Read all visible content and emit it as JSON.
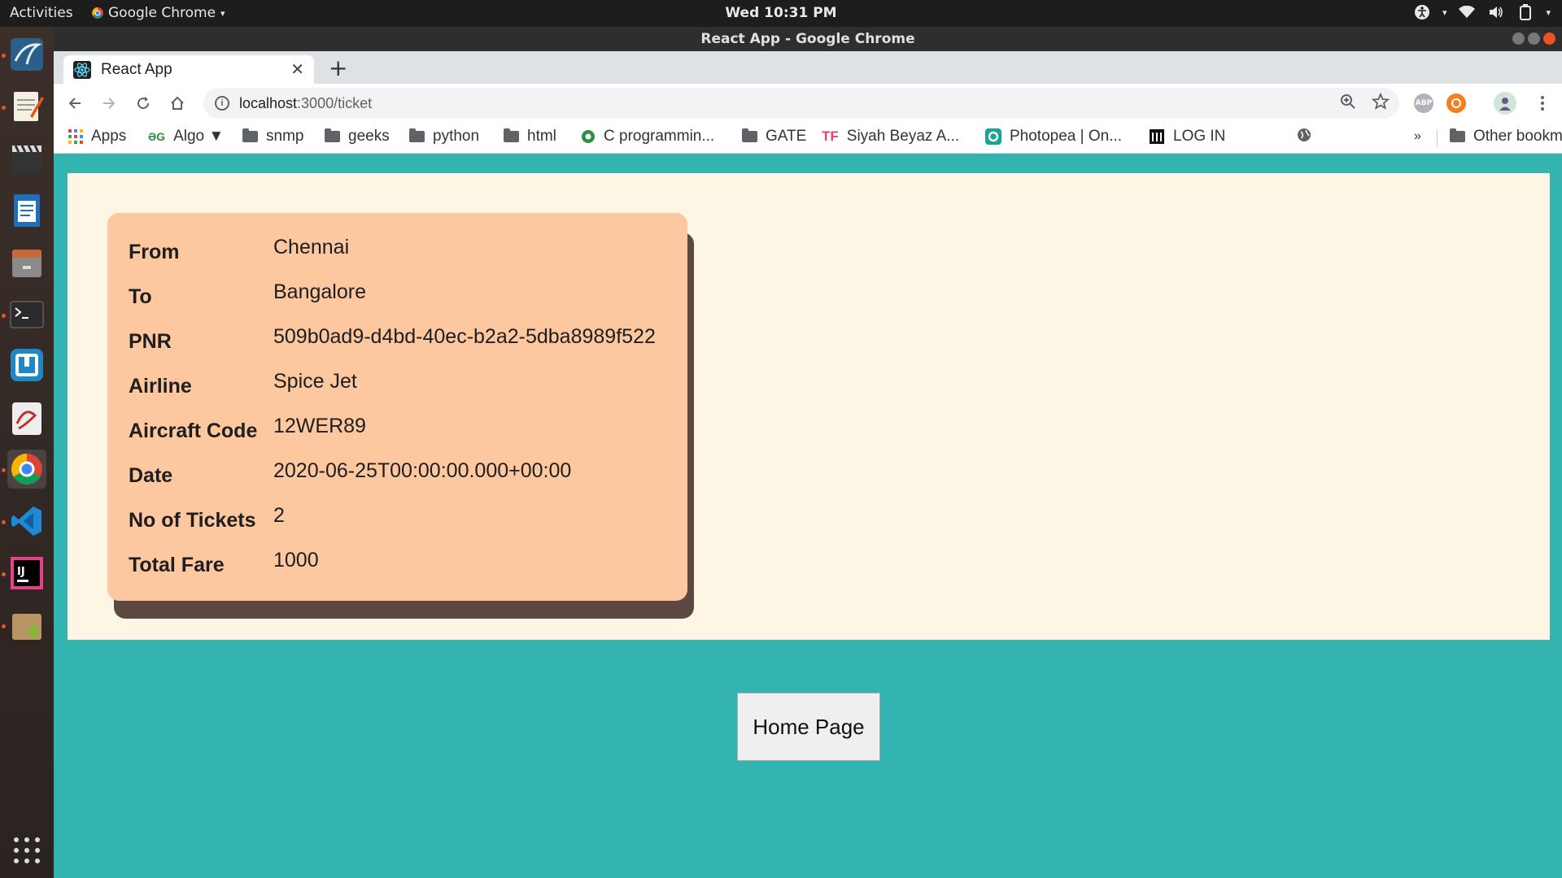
{
  "topbar": {
    "activities": "Activities",
    "app_menu": "Google Chrome",
    "clock": "Wed 10:31 PM"
  },
  "window": {
    "title": "React App - Google Chrome"
  },
  "tab": {
    "title": "React App"
  },
  "omnibox": {
    "host": "localhost",
    "path": ":3000/ticket"
  },
  "bookmarks": [
    "Apps",
    "Algo ▼",
    "snmp",
    "geeks",
    "python",
    "html",
    "C programmin...",
    "GATE",
    "Siyah Beyaz A...",
    "Photopea | On...",
    "LOG IN"
  ],
  "bookmarks_more": "»",
  "other_bookmarks": "Other bookmarks",
  "ticket": {
    "rows": [
      {
        "label": "From",
        "value": "Chennai"
      },
      {
        "label": "To",
        "value": "Bangalore"
      },
      {
        "label": "PNR",
        "value": "509b0ad9-d4bd-40ec-b2a2-5dba8989f522"
      },
      {
        "label": "Airline",
        "value": "Spice Jet"
      },
      {
        "label": "Aircraft Code",
        "value": "12WER89"
      },
      {
        "label": "Date",
        "value": "2020-06-25T00:00:00.000+00:00"
      },
      {
        "label": "No of Tickets",
        "value": "2"
      },
      {
        "label": "Total Fare",
        "value": "1000"
      }
    ]
  },
  "home_button": "Home Page",
  "colors": {
    "page_bg": "#33b4b1",
    "panel_bg": "#fef6e4",
    "card_bg": "#fdc7a0",
    "card_shadow": "#5c4841"
  }
}
